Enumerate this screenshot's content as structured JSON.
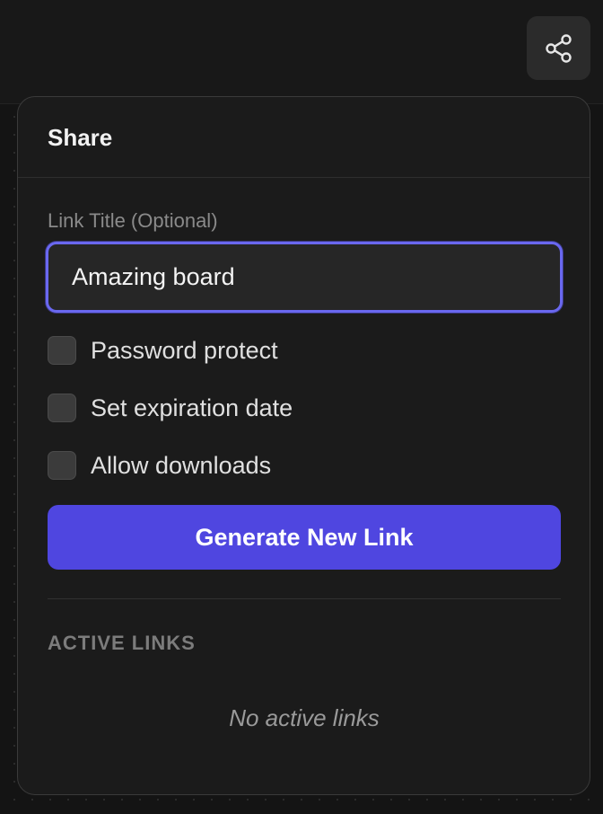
{
  "toolbar": {
    "share_icon": "share-icon"
  },
  "share_panel": {
    "title": "Share",
    "link_title": {
      "label": "Link Title (Optional)",
      "value": "Amazing board"
    },
    "options": [
      {
        "label": "Password protect",
        "checked": false
      },
      {
        "label": "Set expiration date",
        "checked": false
      },
      {
        "label": "Allow downloads",
        "checked": false
      }
    ],
    "generate_label": "Generate New Link",
    "active_links": {
      "heading": "ACTIVE LINKS",
      "empty_text": "No active links"
    }
  },
  "colors": {
    "accent": "#4f46e0",
    "focus_ring": "#6a68f0",
    "panel_bg": "#1b1b1b",
    "page_bg": "#161616"
  }
}
